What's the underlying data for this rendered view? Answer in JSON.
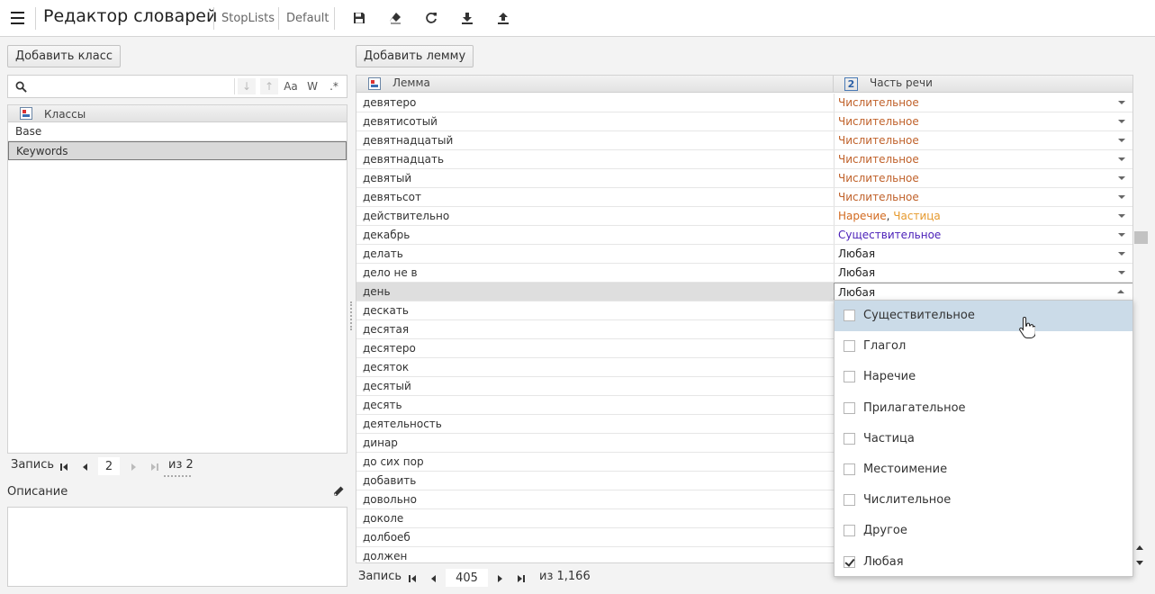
{
  "header": {
    "app_title": "Редактор словарей",
    "crumb_1": "StopLists",
    "crumb_2": "Default",
    "tools": [
      "save-icon",
      "eraser-icon",
      "refresh-icon",
      "download-icon",
      "upload-icon"
    ]
  },
  "classes_panel": {
    "add_button": "Добавить класс",
    "search": {
      "value": "",
      "placeholder": ""
    },
    "search_options": [
      "↓",
      "↑",
      "Aa",
      "W",
      ".*"
    ],
    "column_header": "Классы",
    "rows": [
      "Base",
      "Keywords"
    ],
    "selected_row": "Keywords",
    "pager": {
      "label": "Запись",
      "current": "2",
      "total_label": "из 2"
    },
    "description_label": "Описание",
    "description_value": ""
  },
  "lemmas_panel": {
    "add_button": "Добавить лемму",
    "col_lemma": "Лемма",
    "col_pos": "Часть речи",
    "col_pos_badge": "2",
    "rows": [
      {
        "lemma": "девятеро",
        "pos": [
          {
            "t": "Числительное",
            "c": "#c0622b"
          }
        ]
      },
      {
        "lemma": "девятисотый",
        "pos": [
          {
            "t": "Числительное",
            "c": "#c0622b"
          }
        ]
      },
      {
        "lemma": "девятнадцатый",
        "pos": [
          {
            "t": "Числительное",
            "c": "#c0622b"
          }
        ]
      },
      {
        "lemma": "девятнадцать",
        "pos": [
          {
            "t": "Числительное",
            "c": "#c0622b"
          }
        ]
      },
      {
        "lemma": "девятый",
        "pos": [
          {
            "t": "Числительное",
            "c": "#c0622b"
          }
        ]
      },
      {
        "lemma": "девятьсот",
        "pos": [
          {
            "t": "Числительное",
            "c": "#c0622b"
          }
        ]
      },
      {
        "lemma": "действительно",
        "pos": [
          {
            "t": "Наречие",
            "c": "#d2691e"
          },
          {
            "t": ", ",
            "c": "#333333"
          },
          {
            "t": "Частица",
            "c": "#e69a2e"
          }
        ]
      },
      {
        "lemma": "декабрь",
        "pos": [
          {
            "t": "Существительное",
            "c": "#4a1fb8"
          }
        ]
      },
      {
        "lemma": "делать",
        "pos": [
          {
            "t": "Любая",
            "c": "#222222"
          }
        ]
      },
      {
        "lemma": "дело не в",
        "pos": [
          {
            "t": "Любая",
            "c": "#222222"
          }
        ]
      },
      {
        "lemma": "день",
        "pos": [
          {
            "t": "Любая",
            "c": "#222222"
          }
        ]
      },
      {
        "lemma": "дескать",
        "pos": []
      },
      {
        "lemma": "десятая",
        "pos": []
      },
      {
        "lemma": "десятеро",
        "pos": []
      },
      {
        "lemma": "десяток",
        "pos": []
      },
      {
        "lemma": "десятый",
        "pos": []
      },
      {
        "lemma": "десять",
        "pos": []
      },
      {
        "lemma": "деятельность",
        "pos": []
      },
      {
        "lemma": "динар",
        "pos": []
      },
      {
        "lemma": "до сих пор",
        "pos": []
      },
      {
        "lemma": "добавить",
        "pos": []
      },
      {
        "lemma": "довольно",
        "pos": []
      },
      {
        "lemma": "доколе",
        "pos": []
      },
      {
        "lemma": "долбоеб",
        "pos": []
      },
      {
        "lemma": "должен",
        "pos": []
      }
    ],
    "selected_row": 10,
    "pager": {
      "label": "Запись",
      "current": "405",
      "total_label": "из 1,166"
    }
  },
  "pos_dropdown": {
    "options": [
      {
        "label": "Существительное",
        "checked": false,
        "hover": true
      },
      {
        "label": "Глагол",
        "checked": false,
        "hover": false
      },
      {
        "label": "Наречие",
        "checked": false,
        "hover": false
      },
      {
        "label": "Прилагательное",
        "checked": false,
        "hover": false
      },
      {
        "label": "Частица",
        "checked": false,
        "hover": false
      },
      {
        "label": "Местоимение",
        "checked": false,
        "hover": false
      },
      {
        "label": "Числительное",
        "checked": false,
        "hover": false
      },
      {
        "label": "Другое",
        "checked": false,
        "hover": false
      },
      {
        "label": "Любая",
        "checked": true,
        "hover": false
      }
    ]
  }
}
